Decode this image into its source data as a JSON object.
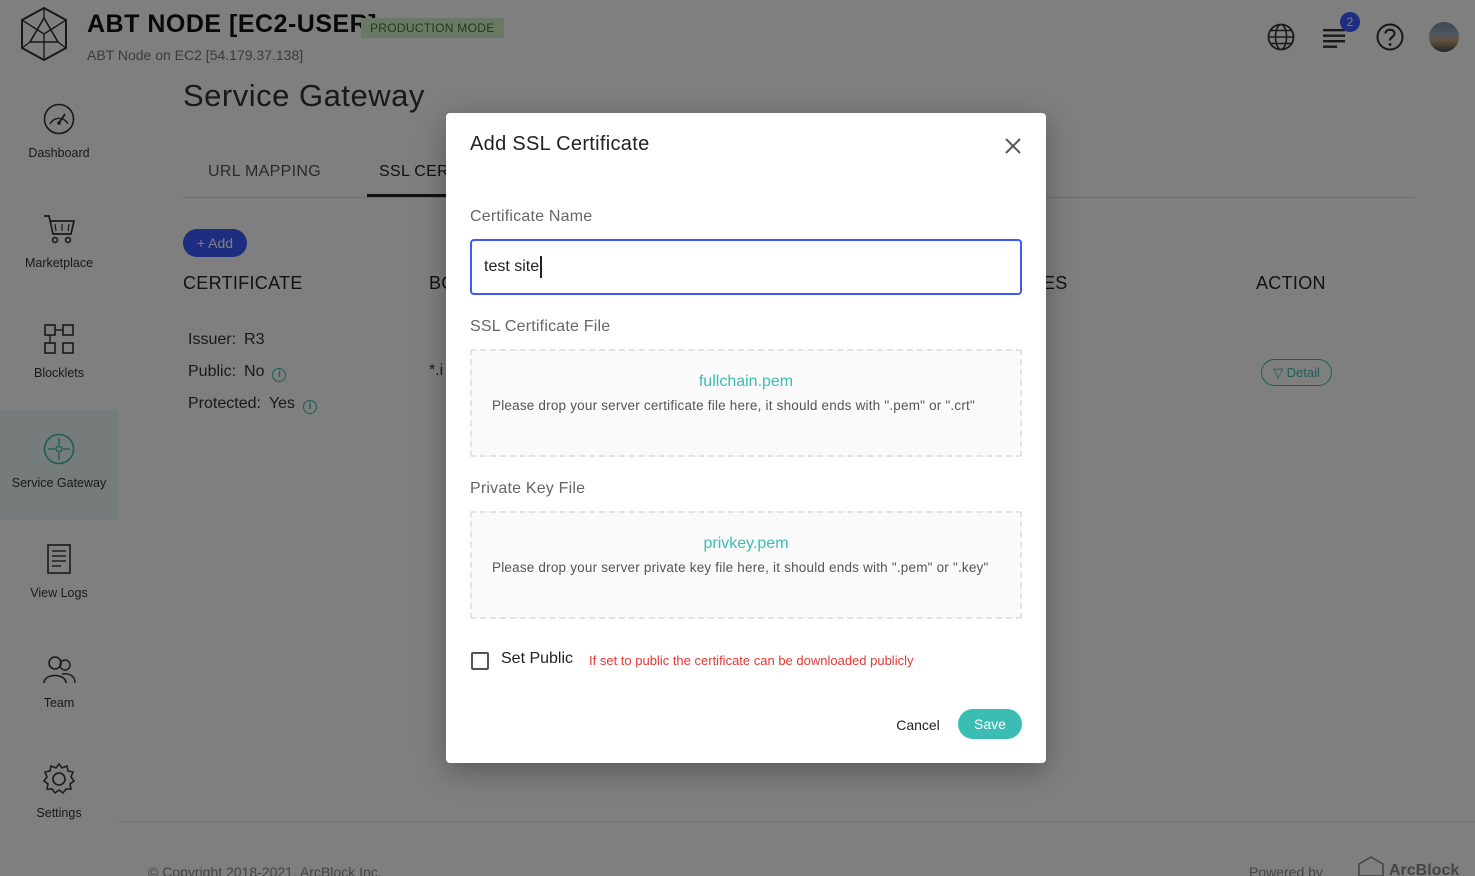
{
  "header": {
    "title": "ABT NODE [EC2-USER]",
    "mode_badge": "PRODUCTION MODE",
    "subtitle": "ABT Node on EC2 [54.179.37.138]",
    "notification_count": "2"
  },
  "sidebar": {
    "items": [
      {
        "label": "Dashboard",
        "icon": "gauge-icon"
      },
      {
        "label": "Marketplace",
        "icon": "cart-icon"
      },
      {
        "label": "Blocklets",
        "icon": "blocks-icon"
      },
      {
        "label": "Service Gateway",
        "icon": "gateway-icon",
        "active": true
      },
      {
        "label": "View Logs",
        "icon": "logs-icon"
      },
      {
        "label": "Team",
        "icon": "team-icon"
      },
      {
        "label": "Settings",
        "icon": "gear-icon"
      }
    ]
  },
  "main": {
    "title": "Service Gateway",
    "tabs": [
      {
        "label": "URL MAPPING"
      },
      {
        "label": "SSL CERT",
        "active": true
      }
    ],
    "add_label": "+ Add",
    "columns": [
      "CERTIFICATE",
      "BO",
      "ES",
      "ACTION"
    ],
    "row": {
      "issuer_label": "Issuer:",
      "issuer_value": "R3",
      "public_label": "Public:",
      "public_value": "No",
      "protected_label": "Protected:",
      "protected_value": "Yes",
      "domain": "*.i",
      "detail_label": "▽ Detail"
    }
  },
  "footer": {
    "copyright": "© Copyright 2018-2021, ArcBlock Inc.",
    "powered": "Powered by",
    "brand": "ArcBlock"
  },
  "dialog": {
    "title": "Add SSL Certificate",
    "name_label": "Certificate Name",
    "name_value": "test site",
    "cert_label": "SSL Certificate File",
    "cert_file": "fullchain.pem",
    "cert_hint": "Please drop your server certificate file here, it should ends with \".pem\" or \".crt\"",
    "key_label": "Private Key File",
    "key_file": "privkey.pem",
    "key_hint": "Please drop your server private key file here, it should ends with \".pem\" or \".key\"",
    "public_label": "Set Public",
    "public_hint": "If set to public the certificate can be downloaded publicly",
    "cancel_label": "Cancel",
    "save_label": "Save"
  },
  "colors": {
    "primary": "#3d5afe",
    "accent": "#3bbdb3",
    "error": "#e53935",
    "badge_bg": "#d7f0c9"
  }
}
